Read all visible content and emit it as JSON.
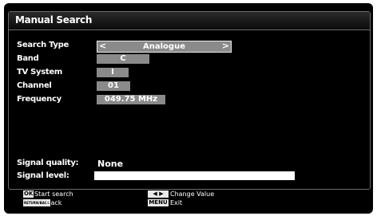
{
  "title": "Manual Search",
  "fields": [
    {
      "label": "Search Type",
      "value": "Analogue"
    },
    {
      "label": "Band",
      "value": "C"
    },
    {
      "label": "TV System",
      "value": "I"
    },
    {
      "label": "Channel",
      "value": "01"
    },
    {
      "label": "Frequency",
      "value": "049.75 MHz"
    }
  ],
  "signal": {
    "quality_label": "Signal quality:",
    "quality_value": "None",
    "level_label": "Signal level:",
    "level_fraction": 1.0
  },
  "footer": {
    "ok_key": "OK",
    "ok_label": "Start search",
    "back_key": "RETURN/BACK",
    "back_label": "Back",
    "lr_keys": "◀ ▶",
    "change_label": "Change Value",
    "menu_key": "MENU",
    "menu_label": "Exit"
  },
  "icons": {
    "left": "chevron-left-icon",
    "right": "chevron-right-icon"
  },
  "colors": {
    "background": "#000000",
    "field": "#8a8a8a",
    "text": "#ffffff"
  }
}
